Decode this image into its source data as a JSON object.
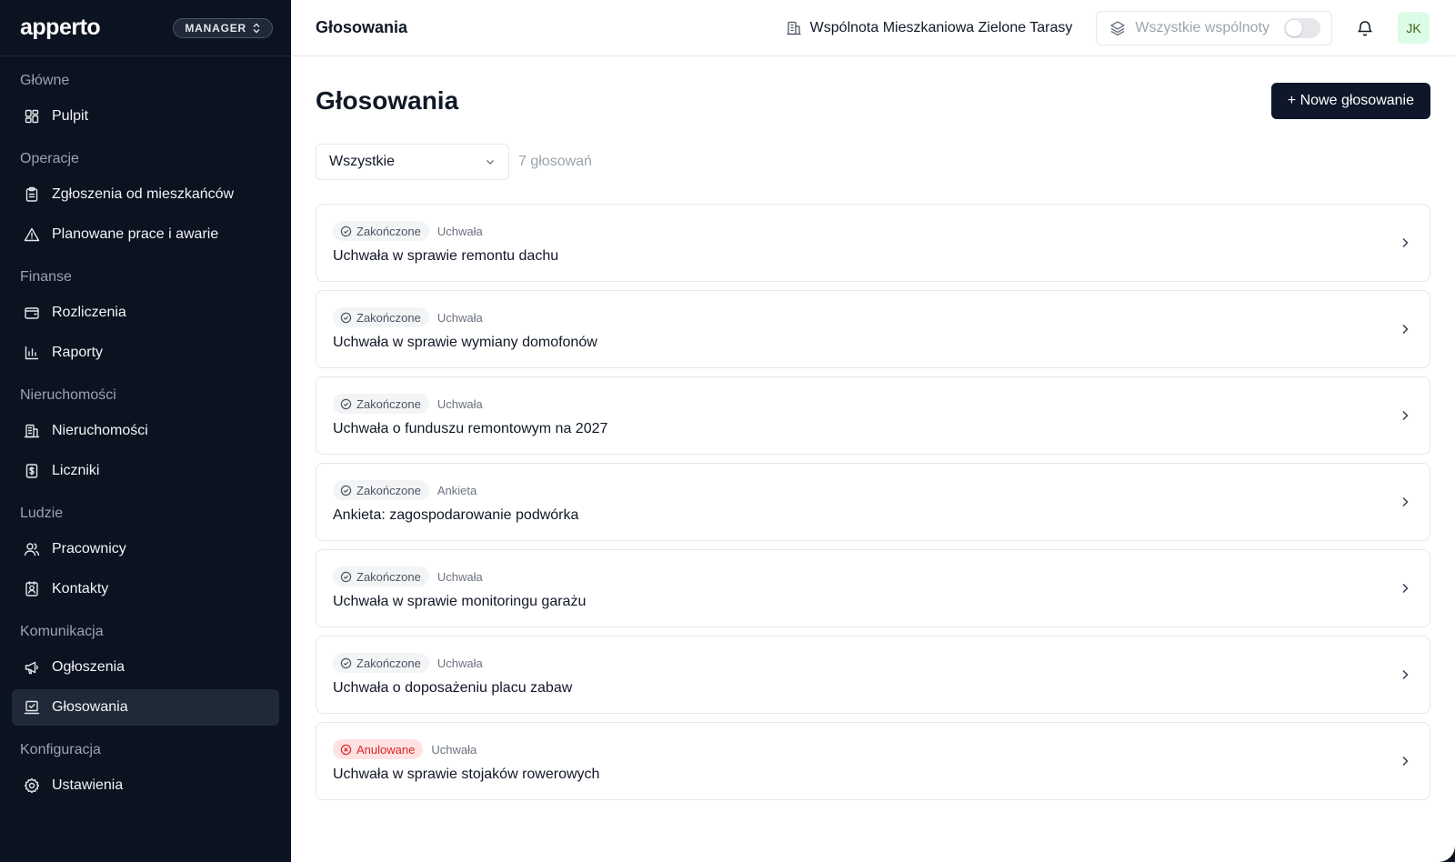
{
  "app": {
    "logo": "apperto",
    "role": "MANAGER"
  },
  "sidebar": {
    "sections": [
      {
        "title": "Główne",
        "items": [
          {
            "label": "Pulpit",
            "icon": "dashboard-icon"
          }
        ]
      },
      {
        "title": "Operacje",
        "items": [
          {
            "label": "Zgłoszenia od mieszkańców",
            "icon": "clipboard-icon"
          },
          {
            "label": "Planowane prace i awarie",
            "icon": "warning-icon"
          }
        ]
      },
      {
        "title": "Finanse",
        "items": [
          {
            "label": "Rozliczenia",
            "icon": "wallet-icon"
          },
          {
            "label": "Raporty",
            "icon": "bar-chart-icon"
          }
        ]
      },
      {
        "title": "Nieruchomości",
        "items": [
          {
            "label": "Nieruchomości",
            "icon": "building-icon"
          },
          {
            "label": "Liczniki",
            "icon": "meter-icon"
          }
        ]
      },
      {
        "title": "Ludzie",
        "items": [
          {
            "label": "Pracownicy",
            "icon": "users-icon"
          },
          {
            "label": "Kontakty",
            "icon": "contact-icon"
          }
        ]
      },
      {
        "title": "Komunikacja",
        "items": [
          {
            "label": "Ogłoszenia",
            "icon": "megaphone-icon"
          },
          {
            "label": "Głosowania",
            "icon": "vote-icon",
            "active": true
          }
        ]
      },
      {
        "title": "Konfiguracja",
        "items": [
          {
            "label": "Ustawienia",
            "icon": "gear-icon"
          }
        ]
      }
    ]
  },
  "topbar": {
    "title": "Głosowania",
    "community": "Wspólnota Mieszkaniowa Zielone Tarasy",
    "all_communities": "Wszystkie wspólnoty",
    "avatar": "JK"
  },
  "page": {
    "title": "Głosowania",
    "new_button": "+ Nowe głosowanie",
    "filter_value": "Wszystkie",
    "count": "7 głosowań"
  },
  "votes": [
    {
      "status": "Zakończone",
      "status_kind": "done",
      "type": "Uchwała",
      "title": "Uchwała w sprawie remontu dachu"
    },
    {
      "status": "Zakończone",
      "status_kind": "done",
      "type": "Uchwała",
      "title": "Uchwała w sprawie wymiany domofonów"
    },
    {
      "status": "Zakończone",
      "status_kind": "done",
      "type": "Uchwała",
      "title": "Uchwała o funduszu remontowym na 2027"
    },
    {
      "status": "Zakończone",
      "status_kind": "done",
      "type": "Ankieta",
      "title": "Ankieta: zagospodarowanie podwórka"
    },
    {
      "status": "Zakończone",
      "status_kind": "done",
      "type": "Uchwała",
      "title": "Uchwała w sprawie monitoringu garażu"
    },
    {
      "status": "Zakończone",
      "status_kind": "done",
      "type": "Uchwała",
      "title": "Uchwała o doposażeniu placu zabaw"
    },
    {
      "status": "Anulowane",
      "status_kind": "cancel",
      "type": "Uchwała",
      "title": "Uchwała w sprawie stojaków rowerowych"
    }
  ]
}
